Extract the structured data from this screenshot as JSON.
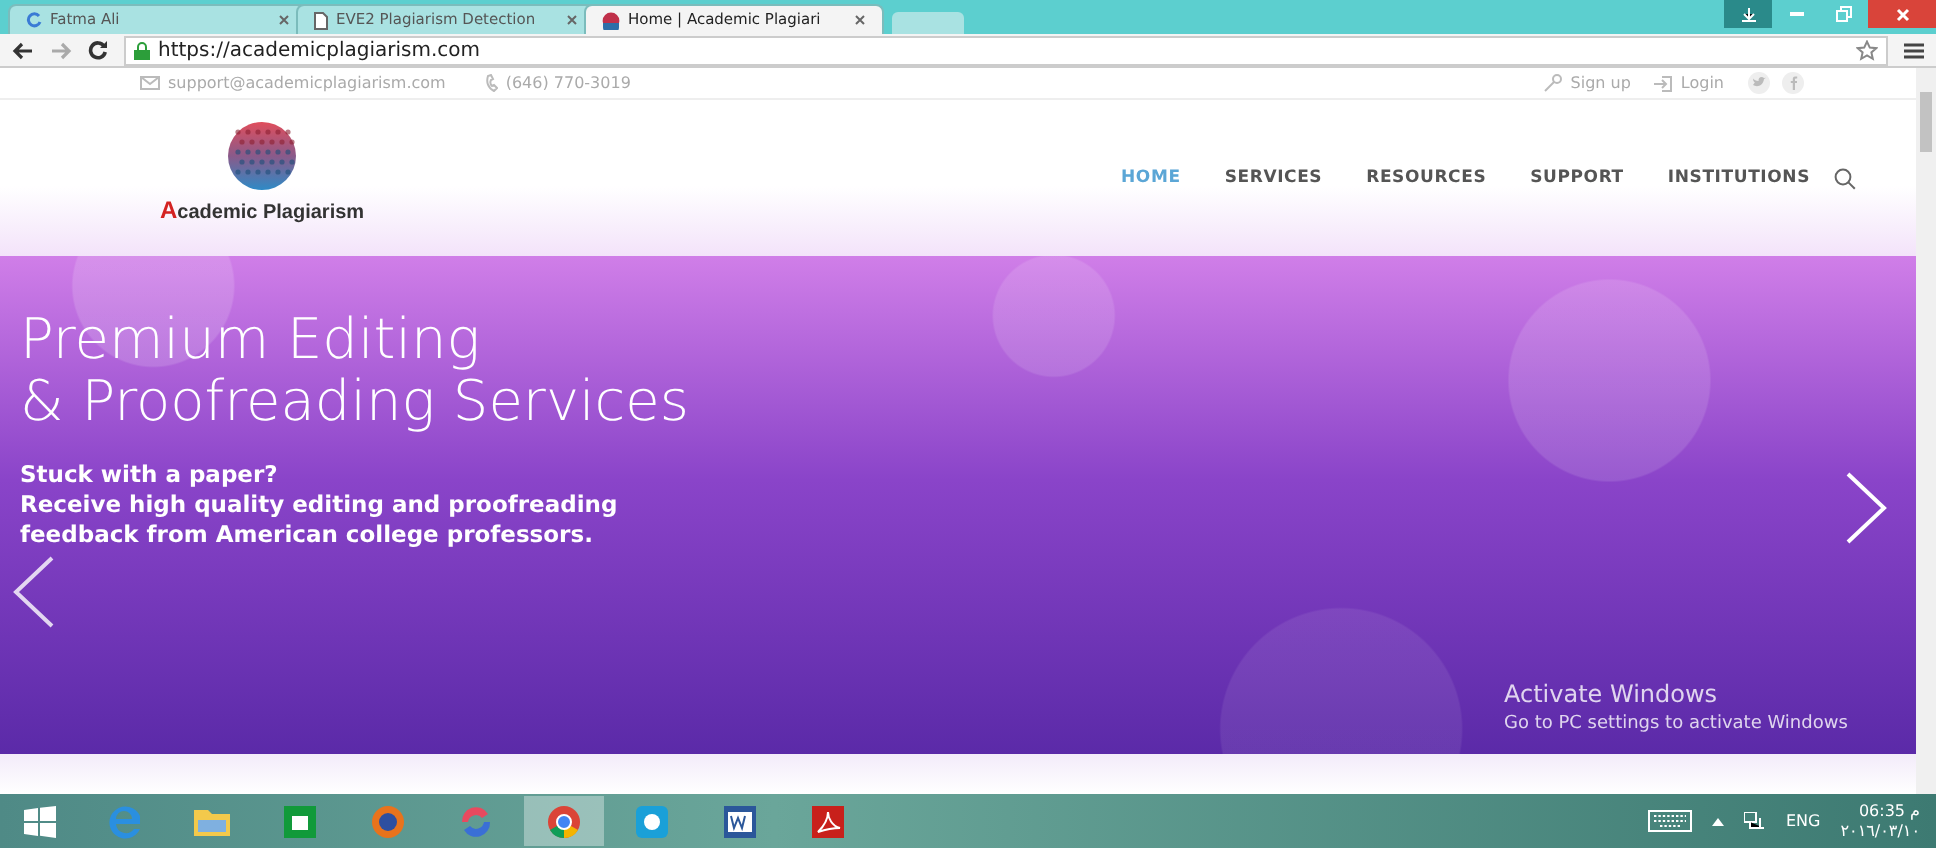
{
  "browser": {
    "tabs": [
      {
        "title": "Fatma Ali",
        "selected": false
      },
      {
        "title": "EVE2 Plagiarism Detection",
        "selected": false
      },
      {
        "title": "Home | Academic Plagiari",
        "selected": true
      }
    ],
    "address": "https://academicplagiarism.com"
  },
  "topbar": {
    "email": "support@academicplagiarism.com",
    "phone": "(646) 770-3019",
    "signup": "Sign up",
    "login": "Login"
  },
  "logo": {
    "name": "Academic Plagiarism"
  },
  "nav": [
    {
      "label": "HOME",
      "selected": true
    },
    {
      "label": "SERVICES",
      "selected": false
    },
    {
      "label": "RESOURCES",
      "selected": false
    },
    {
      "label": "SUPPORT",
      "selected": false
    },
    {
      "label": "INSTITUTIONS",
      "selected": false
    }
  ],
  "hero": {
    "title_lines": [
      "Premium Editing",
      "& Proofreading Services"
    ],
    "lines": [
      "Stuck with a paper?",
      "Receive high quality editing and proofreading",
      "feedback from American college professors."
    ]
  },
  "activation": {
    "title": "Activate Windows",
    "text": "Go to PC settings to activate Windows"
  },
  "taskbar": {
    "apps": [
      {
        "kind": "ie",
        "selected": false
      },
      {
        "kind": "folder",
        "selected": false
      },
      {
        "kind": "store",
        "selected": false
      },
      {
        "kind": "firefox",
        "selected": false
      },
      {
        "kind": "swirl",
        "selected": false
      },
      {
        "kind": "chrome",
        "selected": true
      },
      {
        "kind": "skype",
        "selected": false
      },
      {
        "kind": "word",
        "selected": false
      },
      {
        "kind": "pdf",
        "selected": false
      }
    ],
    "language": "ENG",
    "time": "06:35 م",
    "date": "٢٠١٦/٠٣/١٠"
  }
}
